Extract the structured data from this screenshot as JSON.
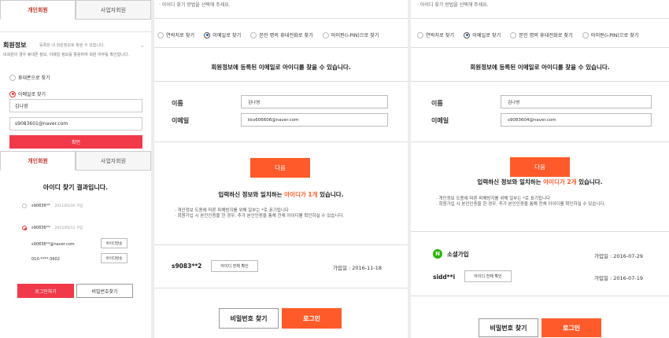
{
  "panel1": {
    "tabs": [
      "개인회원",
      "사업자회원"
    ],
    "info_title": "회원정보",
    "info_sub": "등록된 내 회원정보로 찾을 수 있습니다.",
    "info_desc": "비회원의 경우 휴대폰 정보, 이메일 정보를 활용하여 회원 여부를 확인합니다.",
    "radio_phone": "휴대폰으로 찾기",
    "radio_email": "이메일로 찾기",
    "name_value": "김나영",
    "email_value": "s9083601@naver.com",
    "confirm_label": "확인",
    "result_tabs": [
      "개인회원",
      "사업자회원"
    ],
    "result_title": "아이디 찾기 결과입니다.",
    "acct1_id": "s90836**",
    "acct1_date": "2011/05/30 가입",
    "acct2_id": "s90836**",
    "acct2_date": "2015/05/11 가입",
    "acct2_email": "s90836**@naver.com",
    "acct2_email_btn": "아이디발송",
    "acct2_phone": "010-****-3602",
    "acct2_phone_btn": "아이디발송",
    "login_btn": "로그인하기",
    "find_pw_btn": "비밀번호찾기"
  },
  "panel2": {
    "top_note": "아이디 찾기 방법을 선택해 주세요.",
    "options": [
      "연락처로 찾기",
      "이메일로 찾기",
      "본인 명의 휴대전화로 찾기",
      "아이핀(i-PIN)으로 찾기"
    ],
    "headline": "회원정보에 등록된 이메일로 아이디를 찾을 수 있습니다.",
    "name_label": "이름",
    "name_value": "김나영",
    "email_label": "이메일",
    "email_value": "kks606606@naver.com",
    "next_btn": "다음",
    "match_prefix": "입력하신 정보와 일치하는 ",
    "match_hl": "아이디가 1개",
    "match_suffix": " 있습니다.",
    "bullet1": "개인정보 도용에 따른 피해방지를 위해 일부는 *로 표기됩니다",
    "bullet2": "회원가입 시 본인인증을 한 경우, 추가 본인인증을 통해 전체 아이디를 확인하실 수 있습니다.",
    "uid": "s9083**2",
    "full_id_btn": "아이디 전체 확인",
    "join_date": "가입일 : 2016-11-18",
    "find_pw_btn": "비밀번호 찾기",
    "login_btn": "로그인"
  },
  "panel3": {
    "top_note": "아이디 찾기 방법을 선택해 주세요.",
    "options": [
      "연락처로 찾기",
      "이메일로 찾기",
      "본인 명의 휴대전화로 찾기",
      "아이핀(i-PIN)으로 찾기"
    ],
    "headline": "회원정보에 등록된 이메일로 아이디를 찾을 수 있습니다.",
    "name_label": "이름",
    "name_value": "김나영",
    "email_label": "이메일",
    "email_value": "s9083604@naver.com",
    "next_btn": "다음",
    "match_prefix": "입력하신 정보와 일치하는 ",
    "match_hl": "아이디가 2개",
    "match_suffix": " 있습니다.",
    "bullet1": "개인정보 도용에 따른 피해방지를 위해 일부는 *로 표기됩니다",
    "bullet2": "회원가입 시 본인인증을 한 경우, 추가 본인인증을 통해 전체 아이디를 확인하실 수 있습니다.",
    "social_icon": "N",
    "social_label": "소셜가입",
    "social_date": "가입일 : 2016-07-29",
    "uid": "sidd**i",
    "full_id_btn": "아이디 전체 확인",
    "join_date": "가입일 : 2016-07-19",
    "find_pw_btn": "비밀번호 찾기",
    "login_btn": "로그인"
  }
}
